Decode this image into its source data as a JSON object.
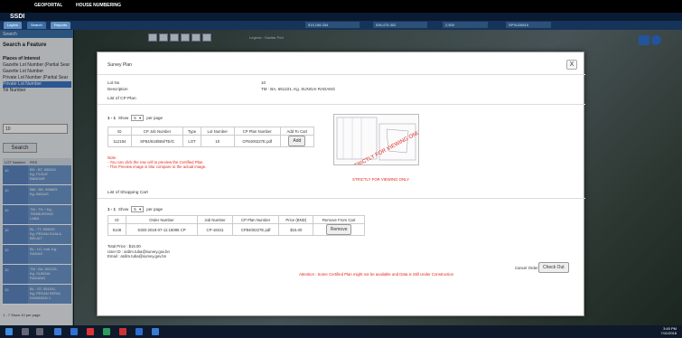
{
  "topnav": {
    "items": [
      "GEOPORTAL",
      "HOUSE NUMBERING"
    ]
  },
  "app": {
    "title": "SSDI"
  },
  "tabs": [
    "Layers",
    "Search",
    "Reports"
  ],
  "stats": [
    "515,158.334",
    "536,475.302",
    "2,500",
    "SPSU26815"
  ],
  "left": {
    "search_label": "Search",
    "heading": "Search a Feature",
    "list": [
      {
        "label": "Places of Interest",
        "head": true
      },
      {
        "label": "Gazette Lot Number (Partial Sear",
        "head": false
      },
      {
        "label": "Gazette Lot Number",
        "head": false
      },
      {
        "label": "Private Lot Number (Partial Sear",
        "head": false
      },
      {
        "label": "Private Lot Number",
        "head": false,
        "selected": true
      },
      {
        "label": "Tol Number",
        "head": false
      }
    ],
    "input_value": "10",
    "search_button": "Search",
    "table_headers": [
      "LOT Number",
      "RSS"
    ],
    "rows": [
      {
        "lot": "10",
        "rss": "BH : BT, 658341\nKg. PUSAT\nBANDAR"
      },
      {
        "lot": "10",
        "rss": "BM : BD, 558825\nKg. BADAS"
      },
      {
        "lot": "10",
        "rss": "TM : TH, / Kg.\nTEMBURONG\nLABA"
      },
      {
        "lot": "10",
        "rss": "BL : TT, 555697,\nKg. PEKAN KUALA\nBELAIT"
      },
      {
        "lot": "10",
        "rss": "BL : LD, mdl. Kg.\nGADAS"
      },
      {
        "lot": "10",
        "rss": "TM : BA, 651221,\nKg. SUNGAI\nRADANG"
      },
      {
        "lot": "10",
        "rss": "BL : ST, 551511,\nKg. PEKAN SERIA\nKAWASAN 1"
      }
    ],
    "pager": "1 - 7  Show  10  per page"
  },
  "map": {
    "legend_label": "Legend : Gazitar Peri"
  },
  "modal": {
    "title": "Survey Plan",
    "close": "X",
    "lot_no_label": "Lot No",
    "lot_no_value": "10",
    "desc_label": "Description",
    "desc_value": "TM : BA, 651221, Kg. SUNGAI RADANG",
    "cp_section": "List of CP Plan",
    "cp_pager": {
      "range": "1 - 1",
      "show": "Show",
      "per_page": "5",
      "suffix": "per page"
    },
    "cp_headers": [
      "ID",
      "CP Job Number",
      "Type",
      "Lot Number",
      "CP Plan Number",
      "Add To Cart"
    ],
    "cp_rows": [
      {
        "id": "112184",
        "job": "SP84/618/BM/TE/G",
        "type": "LOT",
        "lot": "10",
        "plan": "CP8400227E.pdf",
        "action": "Add"
      }
    ],
    "note_title": "Note :",
    "note_lines": [
      "- You can click the row cell to preview the Certified Plan.",
      "- This Preview image is blur compare to the actual image."
    ],
    "watermark": "STRICTLY FOR VIEWING ONLY",
    "preview_caption": "STRICTLY FOR VIEWING ONLY",
    "cart_section": "List of Shopping Cart",
    "cart_pager": {
      "range": "1 - 1",
      "show": "Show",
      "per_page": "5",
      "suffix": "per page"
    },
    "cart_headers": [
      "ID",
      "Order Number",
      "Job Number",
      "CP Plan Number",
      "Price (BND)",
      "Remove From Cart"
    ],
    "cart_rows": [
      {
        "id": "5148",
        "order": "SSDI:2018-07-11:15085 CP",
        "job": "CP-18311",
        "plan": "CP8400227E.pdf",
        "price": "$15.00",
        "action": "Remove"
      }
    ],
    "total_price": "Total Price : $15.00",
    "user_id": "User ID : ardim.tuba@survey.gov.bn",
    "email": "Email : ardim.tuba@survey.gov.bn",
    "attention": "Attention : Some Certified Plan might not be available and Data is Still Under Construction",
    "cancel_order": "Cancel Order",
    "checkout": "Check Out"
  },
  "taskbar": {
    "time": "3:45 PM",
    "date": "7/11/2018"
  }
}
